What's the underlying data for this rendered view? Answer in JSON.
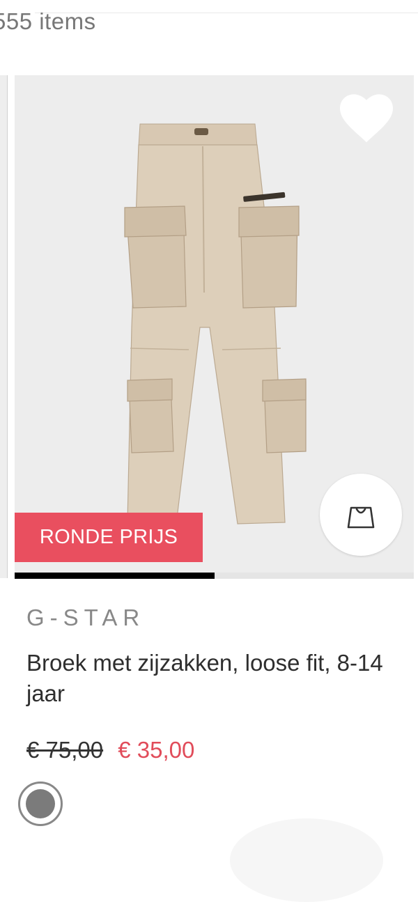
{
  "header": {
    "item_count": "555 items"
  },
  "product": {
    "badge": "RONDE PRIJS",
    "brand": "G-STAR",
    "title": "Broek met zijzakken, loose fit, 8-14 jaar",
    "old_price": "€ 75,00",
    "new_price": "€ 35,00",
    "image_position_fraction": 0.5,
    "colors": {
      "badge": "#e94f5f",
      "sale_price": "#e14c5a",
      "swatch": "#7b7b7b"
    },
    "icons": {
      "favorite": "heart-icon",
      "add_to_bag": "shopping-bag-icon"
    }
  }
}
